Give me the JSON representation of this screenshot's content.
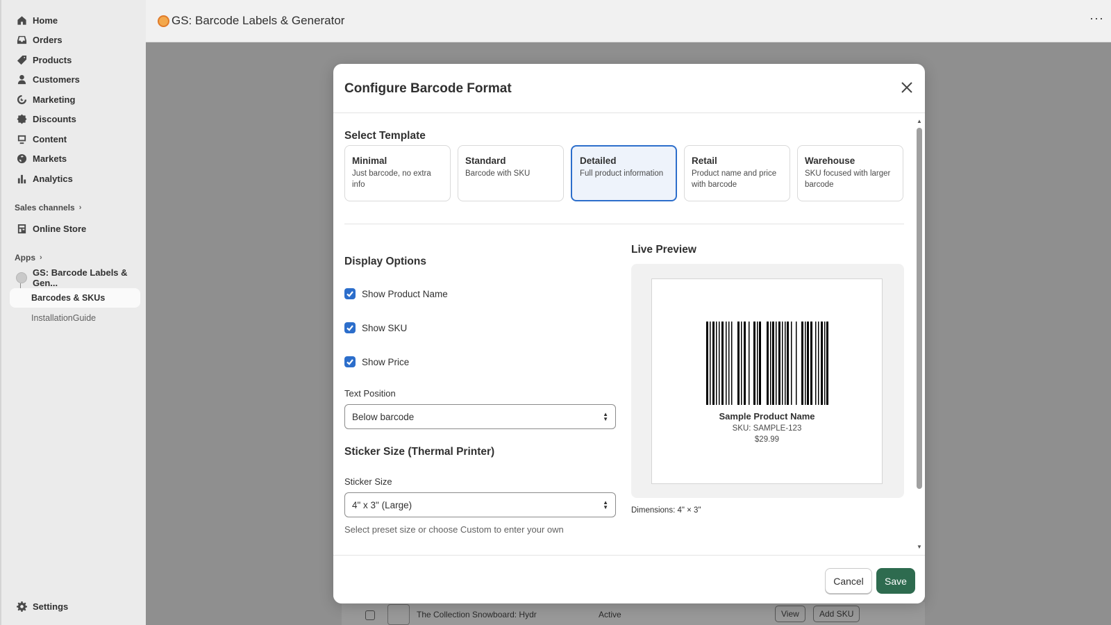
{
  "sidebar": {
    "items": [
      {
        "label": "Home",
        "icon": "home-icon"
      },
      {
        "label": "Orders",
        "icon": "inbox-icon"
      },
      {
        "label": "Products",
        "icon": "tag-icon"
      },
      {
        "label": "Customers",
        "icon": "person-icon"
      },
      {
        "label": "Marketing",
        "icon": "target-icon"
      },
      {
        "label": "Discounts",
        "icon": "discount-icon"
      },
      {
        "label": "Content",
        "icon": "content-icon"
      },
      {
        "label": "Markets",
        "icon": "globe-icon"
      },
      {
        "label": "Analytics",
        "icon": "bar-chart-icon"
      }
    ],
    "sales_channels_label": "Sales channels",
    "online_store": "Online Store",
    "apps_label": "Apps",
    "app_name": "GS: Barcode Labels & Gen...",
    "app_sub_active": "Barcodes & SKUs",
    "app_sub_other": "InstallationGuide",
    "settings": "Settings"
  },
  "header": {
    "title": "GS: Barcode Labels & Generator",
    "more": "···"
  },
  "background_row": {
    "product": "The Collection Snowboard: Hydr",
    "status": "Active",
    "view": "View",
    "add_sku": "Add SKU"
  },
  "modal": {
    "title": "Configure Barcode Format",
    "select_template": "Select Template",
    "templates": [
      {
        "name": "Minimal",
        "desc": "Just barcode, no extra info"
      },
      {
        "name": "Standard",
        "desc": "Barcode with SKU"
      },
      {
        "name": "Detailed",
        "desc": "Full product information"
      },
      {
        "name": "Retail",
        "desc": "Product name and price with barcode"
      },
      {
        "name": "Warehouse",
        "desc": "SKU focused with larger barcode"
      }
    ],
    "selected_template": "Detailed",
    "display_options": "Display Options",
    "show_product_name": "Show Product Name",
    "show_sku": "Show SKU",
    "show_price": "Show Price",
    "text_position_label": "Text Position",
    "text_position_value": "Below barcode",
    "sticker_heading": "Sticker Size (Thermal Printer)",
    "sticker_label": "Sticker Size",
    "sticker_value": "4\" x 3\" (Large)",
    "sticker_help": "Select preset size or choose Custom to enter your own",
    "live_preview": "Live Preview",
    "preview_name": "Sample Product Name",
    "preview_sku": "SKU: SAMPLE-123",
    "preview_price": "$29.99",
    "dimensions": "Dimensions: 4\" × 3\"",
    "cancel": "Cancel",
    "save": "Save"
  },
  "colors": {
    "accent": "#2c6ecb",
    "primary_button": "#2e6b4f"
  }
}
